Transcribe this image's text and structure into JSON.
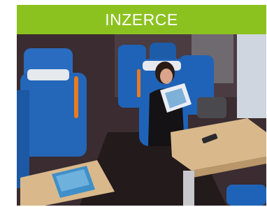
{
  "banner": {
    "title": "INZERCE"
  },
  "colors": {
    "banner": "#8cc220",
    "seat_blue": "#1f63b8",
    "seat_headrest": "#e6e9ee",
    "seat_handle": "#e87b1f",
    "table": "#d9b98c",
    "interior": "#2a1e22"
  },
  "photo": {
    "subject": "woman-reading-magazine-in-train-carriage"
  }
}
